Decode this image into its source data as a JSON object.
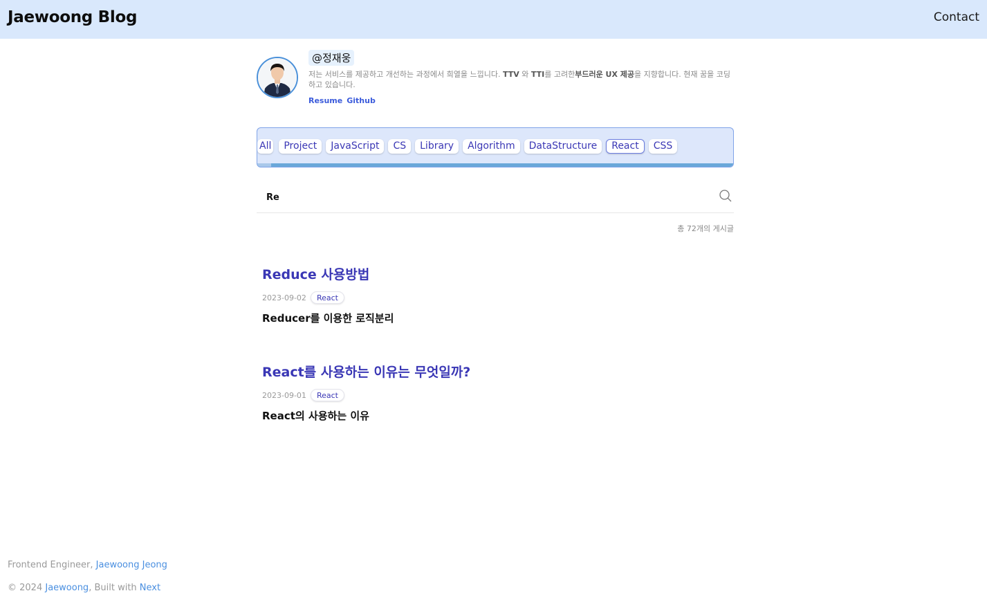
{
  "header": {
    "brand": "Jaewoong Blog",
    "contact": "Contact"
  },
  "profile": {
    "handle": "@정재웅",
    "bio_1": "저는 서비스를 제공하고 개선하는 과정에서 희열을 느낍니다. ",
    "bio_2": "TTV",
    "bio_3": " 와 ",
    "bio_4": "TTI",
    "bio_5": "를 고려한",
    "bio_6": "부드러운 UX 제공",
    "bio_7": "을 지향합니다. 현재 꿈을 코딩하고 있습니다.",
    "links": [
      "Resume",
      "Github"
    ]
  },
  "categories": {
    "items": [
      "All",
      "Project",
      "JavaScript",
      "CS",
      "Library",
      "Algorithm",
      "DataStructure",
      "React",
      "CSS"
    ],
    "active": "React"
  },
  "search": {
    "value": "Re",
    "icon": "search-icon"
  },
  "summary": {
    "count_text": "총 72개의 게시글"
  },
  "posts": [
    {
      "title": "Reduce 사용방법",
      "date": "2023-09-02",
      "tag": "React",
      "description": "Reducer를 이용한 로직분리"
    },
    {
      "title": "React를 사용하는 이유는 무엇일까?",
      "date": "2023-09-01",
      "tag": "React",
      "description": "React의 사용하는 이유"
    }
  ],
  "footer": {
    "line1_prefix": "Frontend Engineer, ",
    "line1_link": "Jaewoong Jeong",
    "line2_prefix": "© 2024 ",
    "line2_link": "Jaewoong",
    "line2_middle": ", Built with ",
    "line2_link2": "Next"
  },
  "colors": {
    "header_bg": "#d9e8fc",
    "accent": "#3a37b5",
    "link": "#4a8fe0"
  }
}
